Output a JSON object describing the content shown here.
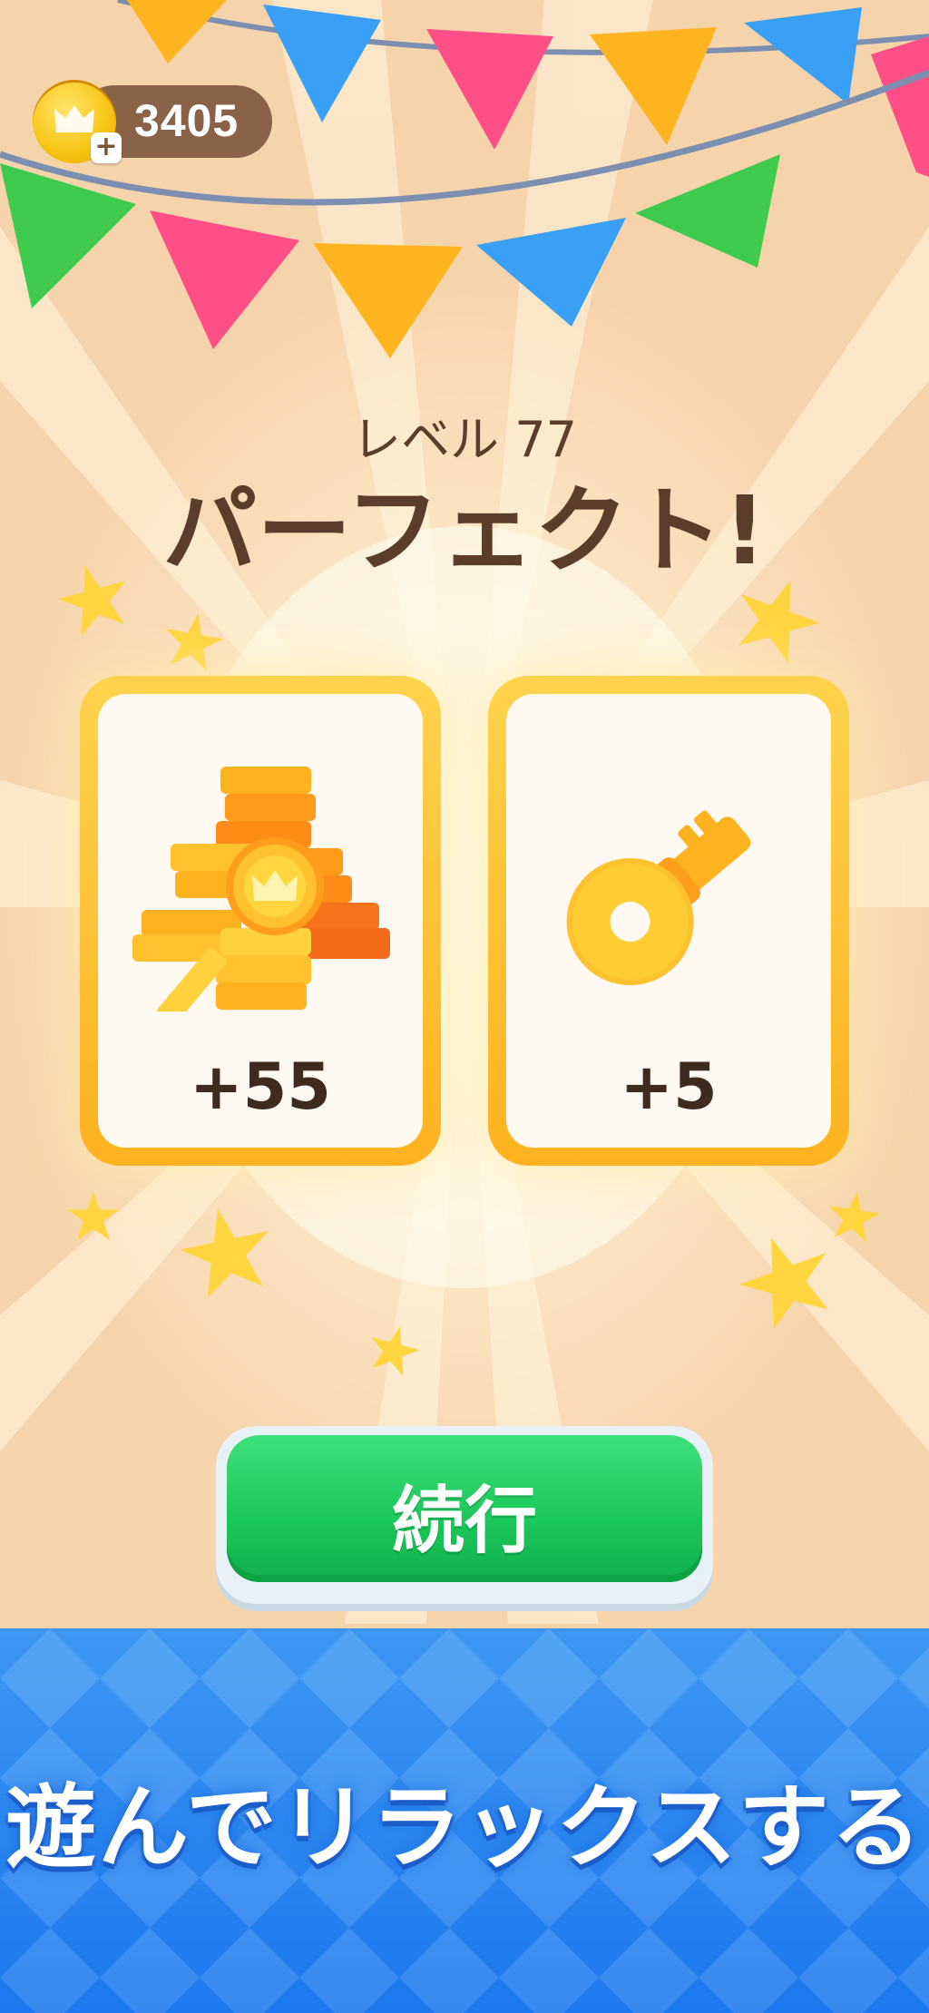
{
  "hud": {
    "coin_count": "3405",
    "add_symbol": "+"
  },
  "result": {
    "level_label": "レベル 77",
    "headline": "パーフェクト!"
  },
  "rewards": [
    {
      "icon": "coin-pile-icon",
      "amount": "+55"
    },
    {
      "icon": "key-icon",
      "amount": "+5"
    }
  ],
  "actions": {
    "continue_label": "続行"
  },
  "banner": {
    "tagline": "遊んでリラックスする"
  },
  "colors": {
    "background": "#fde9cb",
    "text": "#5a3d2b",
    "button": "#19c658",
    "banner": "#1c79ef",
    "card_border": "#ffc02e"
  }
}
